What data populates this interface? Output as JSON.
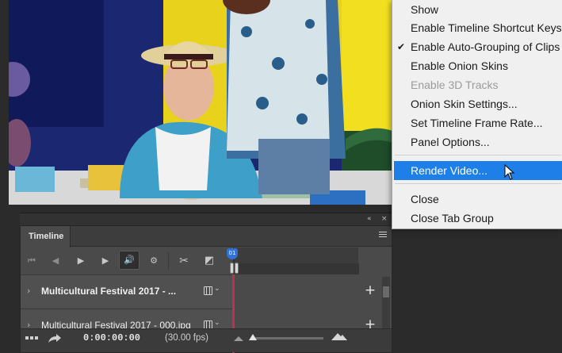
{
  "menu": {
    "items": [
      {
        "label": "Show",
        "state": "normal"
      },
      {
        "label": "Enable Timeline Shortcut Keys",
        "state": "normal"
      },
      {
        "label": "Enable Auto-Grouping of Clips",
        "state": "checked"
      },
      {
        "label": "Enable Onion Skins",
        "state": "normal"
      },
      {
        "label": "Enable 3D Tracks",
        "state": "disabled"
      },
      {
        "label": "Onion Skin Settings...",
        "state": "normal"
      },
      {
        "label": "Set Timeline Frame Rate...",
        "state": "normal"
      },
      {
        "label": "Panel Options...",
        "state": "normal"
      },
      {
        "label": "Render Video...",
        "state": "highlighted"
      },
      {
        "label": "Close",
        "state": "normal"
      },
      {
        "label": "Close Tab Group",
        "state": "normal"
      }
    ],
    "checkmark": "✔",
    "highlight_color": "#1f7fe8"
  },
  "panel": {
    "tab_label": "Timeline",
    "collapse_icon": "«",
    "close_icon": "×",
    "menu_icon": "panel-menu-icon"
  },
  "controls": {
    "first_frame": "⏮",
    "prev_frame": "◀",
    "play": "▶",
    "next_frame": "▶",
    "audio": "🔊",
    "settings": "⚙",
    "split": "✂",
    "transition": "◩"
  },
  "tracks": [
    {
      "name": "Multicultural Festival 2017 - ..."
    },
    {
      "name": "Multicultural Festival 2017 - 000.jpg"
    }
  ],
  "footer": {
    "timecode": "0:00:00:00",
    "fps": "(30.00 fps)"
  },
  "playhead": {
    "color": "#2f72d9",
    "line_color": "#c0304a"
  }
}
